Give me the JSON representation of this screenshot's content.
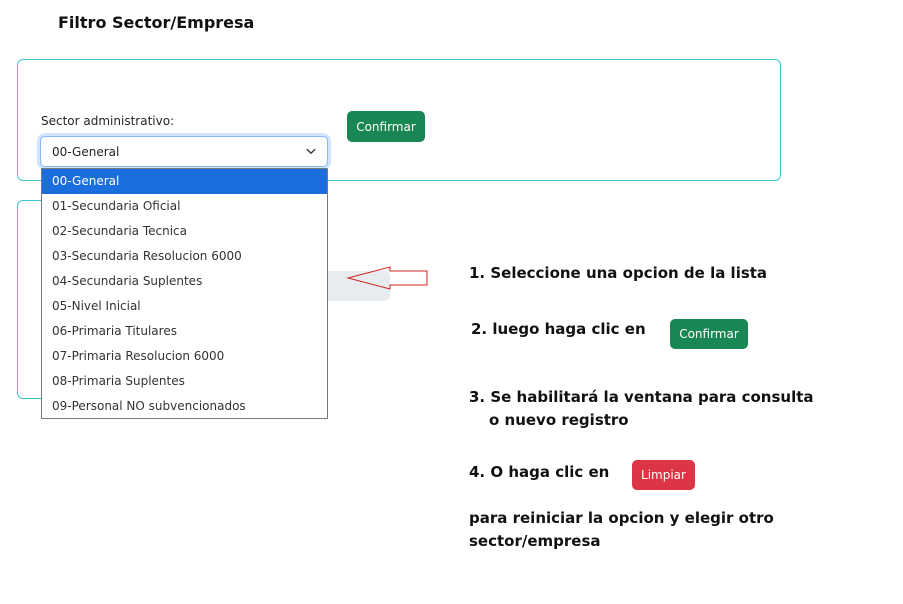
{
  "page": {
    "title": "Filtro Sector/Empresa"
  },
  "filter": {
    "sector_label": "Sector administrativo:",
    "selected_value": "00-General",
    "confirm_label": "Confirmar",
    "options": [
      "00-General",
      "01-Secundaria Oficial",
      "02-Secundaria Tecnica",
      "03-Secundaria Resolucion 6000",
      "04-Secundaria Suplentes",
      "05-Nivel Inicial",
      "06-Primaria Titulares",
      "07-Primaria Resolucion 6000",
      "08-Primaria Suplentes",
      "09-Personal NO subvencionados"
    ]
  },
  "instructions": {
    "step1": "1.  Seleccione una opcion de la lista",
    "step2": "2. luego haga clic en",
    "step2_button": "Confirmar",
    "step3_line1": "3. Se habilitará la ventana para consulta",
    "step3_line2": "o nuevo registro",
    "step4": "4. O haga clic en",
    "step4_button": "Limpiar",
    "step5_line1": "para reiniciar la opcion y elegir otro",
    "step5_line2": "sector/empresa"
  },
  "colors": {
    "confirm": "#198754",
    "clean": "#dc3545",
    "selected_option": "#1a6ede",
    "panel_border": "#3bc6d6",
    "arrow": "#cc2222"
  }
}
